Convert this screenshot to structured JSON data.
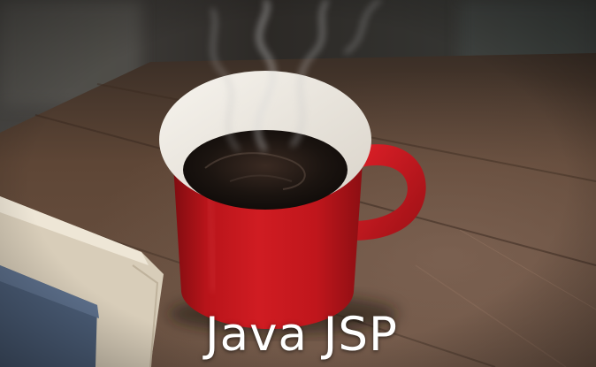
{
  "caption": {
    "text": "Java JSP"
  },
  "colors": {
    "mug": "#c4161c",
    "mug_rim": "#efece6",
    "coffee": "#1d1612",
    "table": "#5a4334",
    "background": "#2b2724",
    "napkin": "#e7ddcc",
    "napkin_blue": "#4d5f78",
    "caption": "#ffffff"
  }
}
